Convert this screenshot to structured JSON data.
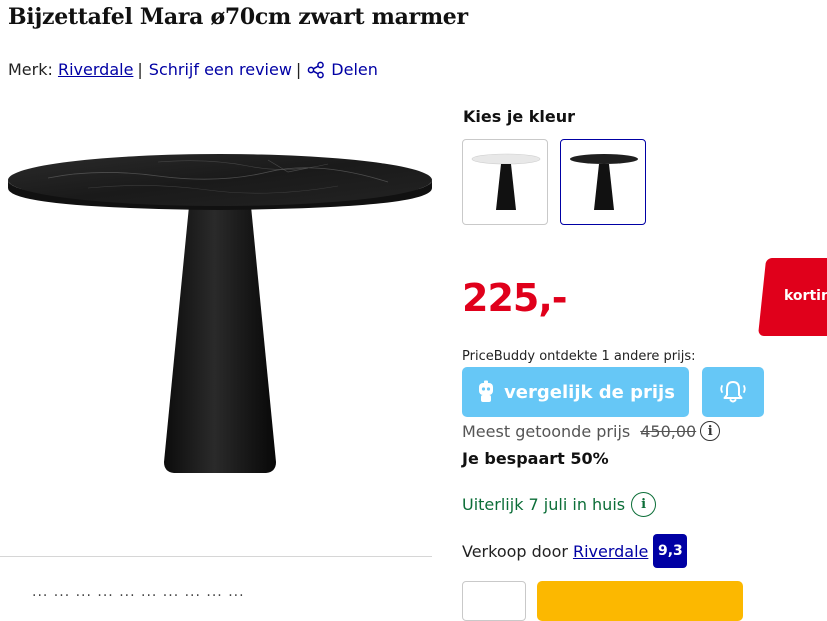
{
  "product": {
    "title": "Bijzettafel Mara ø70cm zwart marmer",
    "brand_prefix": "Merk:",
    "brand": "Riverdale",
    "separator": "|",
    "review_link": "Schrijf een review",
    "share_link": "Delen"
  },
  "color_picker": {
    "heading": "Kies je kleur",
    "options": [
      {
        "name": "wit marmer",
        "top_color": "#e8e8e8"
      },
      {
        "name": "zwart marmer",
        "top_color": "#1f1f1f"
      }
    ],
    "selected_index": 1
  },
  "pricing": {
    "price": "225,-",
    "discount_badge": "korting",
    "pricebuddy_text": "PriceBuddy ontdekte 1 andere prijs:",
    "compare_button": "vergelijk de prijs",
    "most_shown_label": "Meest getoonde prijs",
    "most_shown_price": "450,00",
    "info_glyph": "i",
    "saving": "Je bespaart 50%"
  },
  "delivery": {
    "text": "Uiterlijk 7 juli in huis",
    "info_glyph": "i"
  },
  "seller": {
    "label": "Verkoop door",
    "name": "Riverdale",
    "rating": "9,3"
  },
  "description_fragment": "··· ··· ···  ··· ···  ··· ··· ···  ··· ···",
  "icons": {
    "share": "share-icon",
    "pricebuddy": "pricebuddy-mascot-icon",
    "alert": "bell-alert-icon"
  },
  "colors": {
    "price_red": "#e0001b",
    "link_blue": "#0000a4",
    "button_blue": "#66c7f6",
    "delivery_green": "#0c6e38",
    "cart_yellow": "#fcb800"
  }
}
